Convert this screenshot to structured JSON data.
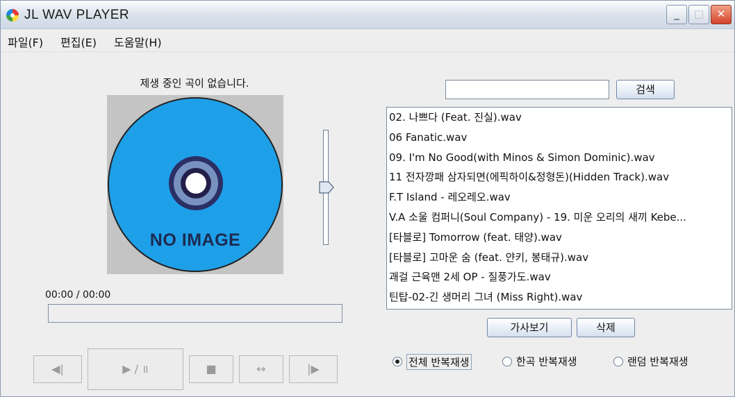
{
  "window": {
    "title": "JL WAV PLAYER",
    "controls": {
      "minimize": "_",
      "maximize": "□",
      "close": "✕"
    }
  },
  "menu": [
    "파일(F)",
    "편집(E)",
    "도움말(H)"
  ],
  "player": {
    "status": "제생 중인 곡이 없습니다.",
    "album_placeholder": "NO IMAGE",
    "time": "00:00 / 00:00",
    "progress": 0,
    "volume": 0.5,
    "controls": {
      "prev": "◀|",
      "play_pause": "▶ / ॥",
      "stop": "■",
      "repeat": "↔",
      "next": "|▶"
    }
  },
  "search": {
    "value": "",
    "button": "검색"
  },
  "playlist": [
    "02. 나쁘다 (Feat. 진실).wav",
    "06 Fanatic.wav",
    "09. I'm No Good(with Minos & Simon Dominic).wav",
    "11 전자깡패 삼자되면(에픽하이&정형돈)(Hidden Track).wav",
    "F.T Island - 레오레오.wav",
    "V.A 소울 컴퍼니(Soul Company) - 19. 미운 오리의 새끼 Kebe...",
    "[타블로] Tomorrow (feat. 태양).wav",
    "[타블로] 고마운 숨 (feat. 얀키, 봉태규).wav",
    "괘걸 근육맨 2세 OP - 질풍가도.wav",
    "틴탑-02-긴 생머리 그녀 (Miss Right).wav"
  ],
  "actions": {
    "lyrics": "가사보기",
    "delete": "삭제"
  },
  "repeat_modes": {
    "selected": 0,
    "options": [
      "전체 반복재생",
      "한곡 반복재생",
      "랜덤 반복재생"
    ]
  },
  "colors": {
    "disc": "#1ea0e8",
    "accent": "#7aa3d6"
  }
}
